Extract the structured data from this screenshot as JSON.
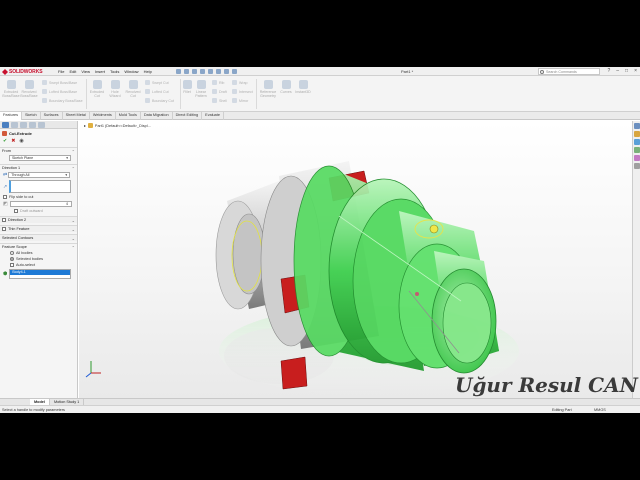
{
  "app": {
    "brand": "SOLIDWORKS",
    "menu": [
      "File",
      "Edit",
      "View",
      "Insert",
      "Tools",
      "Window",
      "Help"
    ],
    "document_title": "Part1 *",
    "search_placeholder": "Search Commands",
    "window_controls": [
      "?",
      "–",
      "□",
      "×"
    ]
  },
  "ribbon": {
    "buttons": [
      {
        "label": "Extruded Boss/Base"
      },
      {
        "label": "Revolved Boss/Base"
      },
      {
        "label": "Swept Boss/Base"
      },
      {
        "label": "Lofted Boss/Base"
      },
      {
        "label": "Boundary Boss/Base"
      },
      {
        "label": "Extruded Cut"
      },
      {
        "label": "Hole Wizard"
      },
      {
        "label": "Revolved Cut"
      },
      {
        "label": "Swept Cut"
      },
      {
        "label": "Lofted Cut"
      },
      {
        "label": "Boundary Cut"
      },
      {
        "label": "Fillet"
      },
      {
        "label": "Linear Pattern"
      },
      {
        "label": "Rib"
      },
      {
        "label": "Draft"
      },
      {
        "label": "Shell"
      },
      {
        "label": "Wrap"
      },
      {
        "label": "Intersect"
      },
      {
        "label": "Mirror"
      },
      {
        "label": "Reference Geometry"
      },
      {
        "label": "Curves"
      },
      {
        "label": "Instant3D"
      }
    ]
  },
  "tabs": [
    "Features",
    "Sketch",
    "Surfaces",
    "Sheet Metal",
    "Weldments",
    "Mold Tools",
    "Data Migration",
    "Direct Editing",
    "Evaluate"
  ],
  "property_manager": {
    "title": "Cut-Extrude",
    "from_label": "From",
    "from_value": "Sketch Plane",
    "direction1_label": "Direction 1",
    "end_condition": "Through All",
    "flip_side_label": "Flip side to cut",
    "draft_label": "Draft outward",
    "direction2_label": "Direction 2",
    "thin_feature_label": "Thin Feature",
    "selected_contours_label": "Selected Contours",
    "feature_scope_label": "Feature Scope",
    "all_bodies_label": "All bodies",
    "selected_bodies_label": "Selected bodies",
    "auto_select_label": "Auto-select",
    "selected_body": "Body4-1"
  },
  "viewport": {
    "breadcrumb": "Part1 (Default<<Default>_Displ..."
  },
  "bottom_tabs": [
    "Model",
    "Motion Study 1"
  ],
  "status": {
    "left": "Select a handle to modify parameters",
    "editing": "Editing Part",
    "units": "MMGS"
  },
  "watermark": "Uğur Resul CAN",
  "colors": {
    "accent_green": "#2fd44a",
    "insert_red": "#c81e1e",
    "body_gray": "#c8c8c8",
    "selection_blue": "#1e7ad6"
  }
}
